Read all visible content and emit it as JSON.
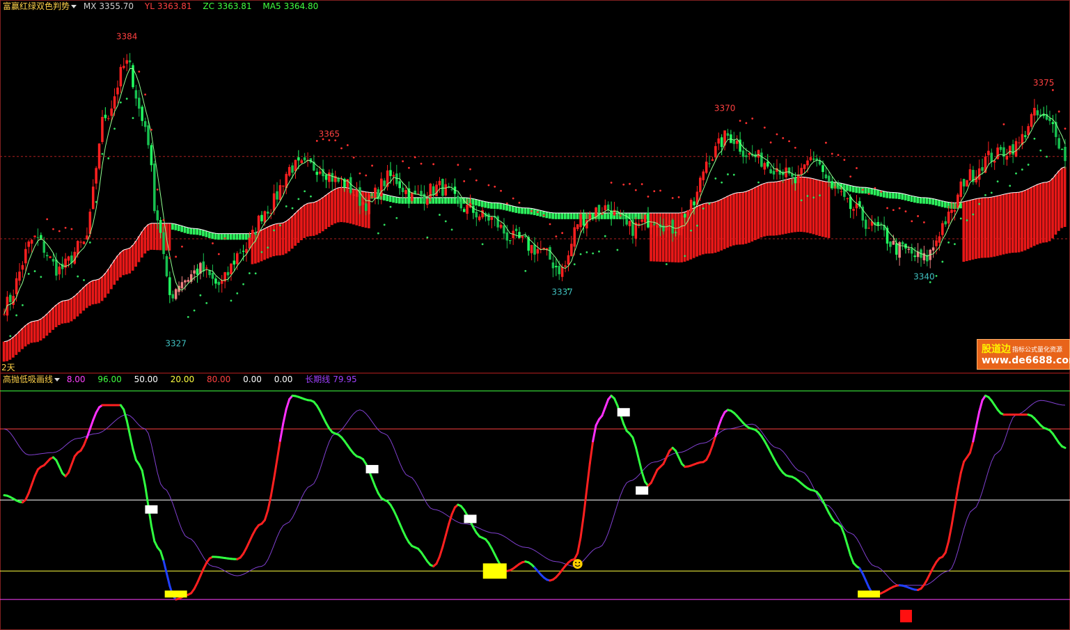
{
  "top_panel": {
    "indicator_name": "富赢红绿双色判势",
    "readouts": [
      {
        "label": "MX",
        "value": "3355.70",
        "color": "#d0d0d0"
      },
      {
        "label": "YL",
        "value": "3363.81",
        "color": "#ff4040"
      },
      {
        "label": "ZC",
        "value": "3363.81",
        "color": "#40ff40"
      },
      {
        "label": "MA5",
        "value": "3364.80",
        "color": "#40ff40"
      }
    ],
    "period_label": "2天"
  },
  "bottom_panel": {
    "indicator_name": "高抛低吸画线",
    "readouts": [
      {
        "label": "",
        "value": "8.00",
        "color": "#ff40ff"
      },
      {
        "label": "",
        "value": "96.00",
        "color": "#40ff40"
      },
      {
        "label": "",
        "value": "50.00",
        "color": "#ffffff"
      },
      {
        "label": "",
        "value": "20.00",
        "color": "#ffff40"
      },
      {
        "label": "",
        "value": "80.00",
        "color": "#ff4040"
      },
      {
        "label": "",
        "value": "0.00",
        "color": "#ffffff"
      },
      {
        "label": "",
        "value": "0.00",
        "color": "#ffffff"
      },
      {
        "label": "长期线",
        "value": "79.95",
        "color": "#a040ff"
      }
    ]
  },
  "watermark": {
    "line1": "股道边",
    "line1_small": "指标公式量化资源",
    "line2": "www.de6688.com"
  },
  "colors": {
    "up": "#ff2020",
    "down": "#20ff60",
    "pink": "#f08080",
    "blue": "#2040ff",
    "purple": "#8040d0",
    "magenta": "#ff30ff",
    "yellow": "#ffff00"
  },
  "chart_data": [
    {
      "type": "candlestick",
      "title": "富赢红绿双色判势",
      "ylim": [
        3320,
        3390
      ],
      "peak_labels": [
        {
          "i": 40,
          "value": 3384,
          "text": "3384",
          "color": "#ff4040"
        },
        {
          "i": 56,
          "value": 3327,
          "text": "3327",
          "color": "#40c0c0"
        },
        {
          "i": 106,
          "value": 3365,
          "text": "3365",
          "color": "#ff4040"
        },
        {
          "i": 182,
          "value": 3337,
          "text": "3337",
          "color": "#40c0c0"
        },
        {
          "i": 235,
          "value": 3370,
          "text": "3370",
          "color": "#ff4040"
        },
        {
          "i": 300,
          "value": 3340,
          "text": "3340",
          "color": "#40c0c0"
        },
        {
          "i": 339,
          "value": 3375,
          "text": "3375",
          "color": "#ff4040"
        }
      ],
      "close_anchors": [
        [
          0,
          3333
        ],
        [
          10,
          3346
        ],
        [
          18,
          3340
        ],
        [
          26,
          3345
        ],
        [
          33,
          3370
        ],
        [
          40,
          3380
        ],
        [
          46,
          3368
        ],
        [
          50,
          3350
        ],
        [
          54,
          3335
        ],
        [
          58,
          3338
        ],
        [
          64,
          3340
        ],
        [
          70,
          3337
        ],
        [
          78,
          3344
        ],
        [
          86,
          3352
        ],
        [
          94,
          3360
        ],
        [
          102,
          3360
        ],
        [
          110,
          3357
        ],
        [
          118,
          3353
        ],
        [
          126,
          3358
        ],
        [
          134,
          3354
        ],
        [
          142,
          3356
        ],
        [
          150,
          3352
        ],
        [
          158,
          3350
        ],
        [
          166,
          3346
        ],
        [
          174,
          3344
        ],
        [
          182,
          3340
        ],
        [
          188,
          3350
        ],
        [
          196,
          3352
        ],
        [
          204,
          3348
        ],
        [
          212,
          3350
        ],
        [
          218,
          3348
        ],
        [
          224,
          3352
        ],
        [
          230,
          3362
        ],
        [
          236,
          3366
        ],
        [
          244,
          3362
        ],
        [
          252,
          3360
        ],
        [
          258,
          3357
        ],
        [
          264,
          3362
        ],
        [
          270,
          3356
        ],
        [
          276,
          3352
        ],
        [
          284,
          3348
        ],
        [
          292,
          3344
        ],
        [
          300,
          3342
        ],
        [
          308,
          3350
        ],
        [
          314,
          3358
        ],
        [
          322,
          3362
        ],
        [
          330,
          3364
        ],
        [
          336,
          3370
        ],
        [
          342,
          3368
        ],
        [
          346,
          3362
        ]
      ],
      "bands": {
        "stair_anchors": [
          [
            0,
            3326
          ],
          [
            10,
            3330
          ],
          [
            20,
            3334
          ],
          [
            30,
            3338
          ],
          [
            40,
            3344
          ],
          [
            48,
            3349
          ],
          [
            54,
            3349
          ],
          [
            62,
            3348
          ],
          [
            70,
            3347
          ],
          [
            80,
            3347
          ],
          [
            90,
            3349
          ],
          [
            100,
            3353
          ],
          [
            110,
            3356
          ],
          [
            120,
            3355
          ],
          [
            130,
            3354
          ],
          [
            140,
            3354
          ],
          [
            150,
            3354
          ],
          [
            160,
            3353
          ],
          [
            170,
            3352
          ],
          [
            180,
            3351
          ],
          [
            190,
            3351
          ],
          [
            200,
            3351
          ],
          [
            210,
            3351
          ],
          [
            220,
            3351
          ],
          [
            230,
            3353
          ],
          [
            240,
            3355
          ],
          [
            250,
            3357
          ],
          [
            260,
            3358
          ],
          [
            270,
            3357
          ],
          [
            280,
            3356
          ],
          [
            290,
            3355
          ],
          [
            300,
            3354
          ],
          [
            310,
            3353
          ],
          [
            320,
            3354
          ],
          [
            330,
            3355
          ],
          [
            340,
            3357
          ],
          [
            346,
            3360
          ]
        ],
        "green_sections": [
          [
            55,
            80
          ],
          [
            120,
            210
          ],
          [
            270,
            312
          ]
        ]
      },
      "sar_dots": "computed",
      "dashed_levels": [
        3362,
        3346
      ]
    },
    {
      "type": "line",
      "title": "高抛低吸画线",
      "ylim": [
        -4,
        100
      ],
      "levels": [
        {
          "value": 96,
          "color": "#40ff40"
        },
        {
          "value": 80,
          "color": "#ff4040"
        },
        {
          "value": 50,
          "color": "#ffffff"
        },
        {
          "value": 20,
          "color": "#ffff40"
        },
        {
          "value": 8,
          "color": "#ff40ff"
        }
      ],
      "short_line_anchors": [
        [
          0,
          52
        ],
        [
          6,
          49
        ],
        [
          12,
          64
        ],
        [
          16,
          68
        ],
        [
          20,
          60
        ],
        [
          24,
          70
        ],
        [
          32,
          90
        ],
        [
          38,
          90
        ],
        [
          44,
          65
        ],
        [
          50,
          30
        ],
        [
          56,
          8
        ],
        [
          60,
          10
        ],
        [
          68,
          26
        ],
        [
          76,
          25
        ],
        [
          84,
          40
        ],
        [
          94,
          94
        ],
        [
          100,
          92
        ],
        [
          108,
          78
        ],
        [
          116,
          68
        ],
        [
          124,
          50
        ],
        [
          134,
          30
        ],
        [
          140,
          22
        ],
        [
          148,
          48
        ],
        [
          156,
          34
        ],
        [
          164,
          20
        ],
        [
          170,
          24
        ],
        [
          178,
          16
        ],
        [
          186,
          25
        ],
        [
          194,
          84
        ],
        [
          198,
          94
        ],
        [
          204,
          78
        ],
        [
          210,
          56
        ],
        [
          214,
          64
        ],
        [
          218,
          72
        ],
        [
          222,
          64
        ],
        [
          228,
          66
        ],
        [
          236,
          88
        ],
        [
          244,
          80
        ],
        [
          256,
          60
        ],
        [
          264,
          54
        ],
        [
          272,
          40
        ],
        [
          278,
          22
        ],
        [
          284,
          10
        ],
        [
          292,
          14
        ],
        [
          298,
          12
        ],
        [
          306,
          26
        ],
        [
          314,
          68
        ],
        [
          320,
          94
        ],
        [
          326,
          86
        ],
        [
          334,
          86
        ],
        [
          340,
          80
        ],
        [
          346,
          72
        ]
      ],
      "long_line_anchors": [
        [
          0,
          80
        ],
        [
          8,
          69
        ],
        [
          16,
          70
        ],
        [
          24,
          76
        ],
        [
          30,
          78
        ],
        [
          40,
          86
        ],
        [
          46,
          80
        ],
        [
          52,
          55
        ],
        [
          60,
          34
        ],
        [
          68,
          22
        ],
        [
          76,
          18
        ],
        [
          84,
          22
        ],
        [
          92,
          40
        ],
        [
          100,
          56
        ],
        [
          108,
          78
        ],
        [
          116,
          88
        ],
        [
          124,
          78
        ],
        [
          132,
          60
        ],
        [
          140,
          46
        ],
        [
          150,
          40
        ],
        [
          160,
          36
        ],
        [
          170,
          30
        ],
        [
          180,
          24
        ],
        [
          186,
          22
        ],
        [
          194,
          30
        ],
        [
          204,
          58
        ],
        [
          212,
          66
        ],
        [
          220,
          70
        ],
        [
          228,
          74
        ],
        [
          236,
          80
        ],
        [
          244,
          82
        ],
        [
          252,
          72
        ],
        [
          260,
          62
        ],
        [
          268,
          48
        ],
        [
          276,
          36
        ],
        [
          284,
          22
        ],
        [
          292,
          14
        ],
        [
          300,
          14
        ],
        [
          308,
          20
        ],
        [
          316,
          46
        ],
        [
          324,
          70
        ],
        [
          330,
          86
        ],
        [
          338,
          92
        ],
        [
          346,
          90
        ]
      ],
      "markers": [
        {
          "i": 48,
          "value": 46,
          "kind": "white"
        },
        {
          "i": 120,
          "value": 63,
          "kind": "white"
        },
        {
          "i": 152,
          "value": 42,
          "kind": "white"
        },
        {
          "i": 202,
          "value": 87,
          "kind": "white"
        },
        {
          "i": 208,
          "value": 54,
          "kind": "white"
        },
        {
          "i": 56,
          "value": 10,
          "kind": "yellow"
        },
        {
          "i": 160,
          "value": 20,
          "kind": "yellow-big"
        },
        {
          "i": 282,
          "value": 10,
          "kind": "yellow"
        },
        {
          "i": 294,
          "value": 1,
          "kind": "red"
        },
        {
          "i": 187,
          "value": 23,
          "kind": "smiley"
        }
      ]
    }
  ]
}
